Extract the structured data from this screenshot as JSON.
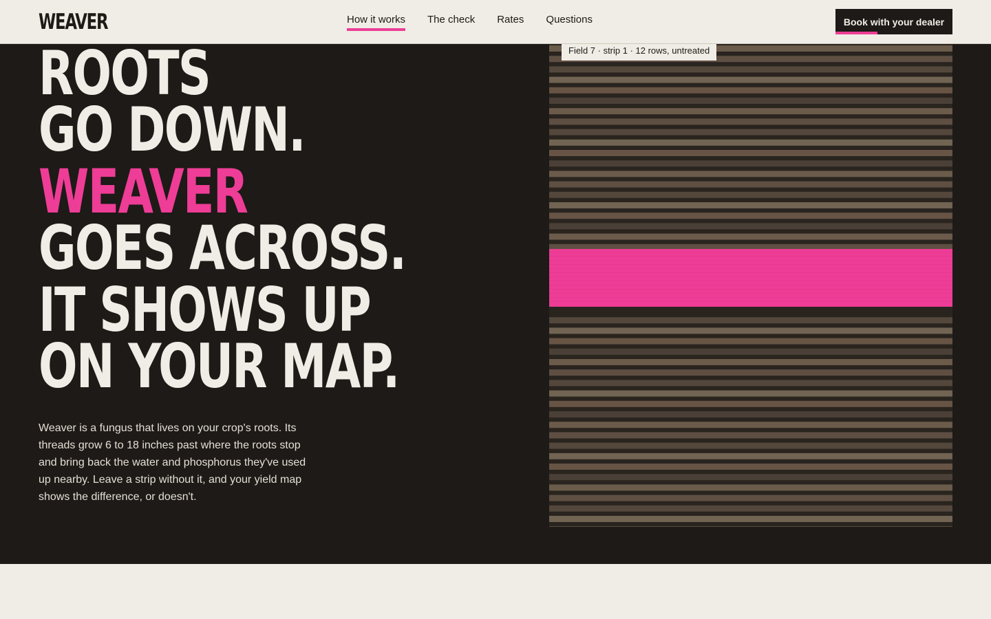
{
  "brand": {
    "logo": "WEAVER"
  },
  "nav": {
    "items": [
      {
        "label": "How it works",
        "active": true
      },
      {
        "label": "The check",
        "active": false
      },
      {
        "label": "Rates",
        "active": false
      },
      {
        "label": "Questions",
        "active": false
      }
    ],
    "cta_label": "Book with your dealer"
  },
  "hero": {
    "headline": {
      "line1": "ROOTS",
      "line2": "GO DOWN.",
      "line3": "WEAVER",
      "line4": "GOES ACROSS.",
      "line5": "IT SHOWS UP",
      "line6": "ON YOUR MAP."
    },
    "body": "Weaver is a fungus that lives on your crop's roots. Its threads grow 6 to 18 inches past where the roots stop and bring back the water and phosphorus they've used up nearby. Leave a strip without it, and your yield map shows the difference, or doesn't."
  },
  "map": {
    "label": "Field 7 · strip 1 · 12 rows, untreated"
  },
  "colors": {
    "ink": "#1d1a17",
    "paper": "#f0ede6",
    "accent": "#ee3d96",
    "soil_light": "#6d5d4b",
    "soil_mid": "#4a3f35",
    "soil_dark": "#2a241f"
  }
}
